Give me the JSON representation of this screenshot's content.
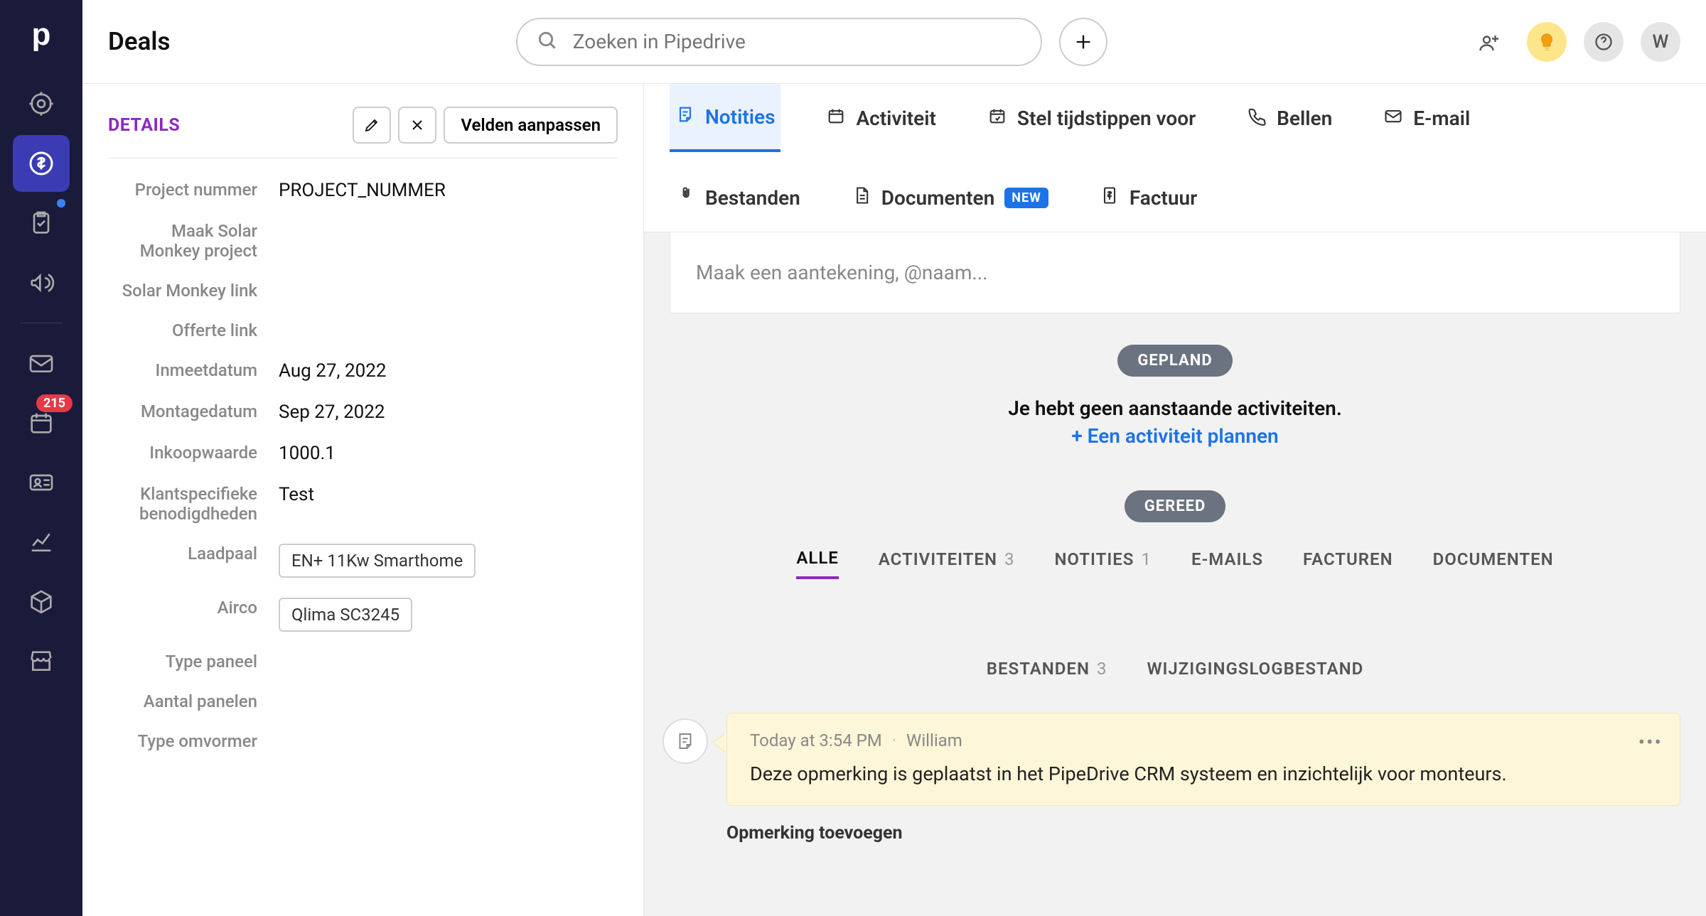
{
  "header": {
    "title": "Deals",
    "search_placeholder": "Zoeken in Pipedrive",
    "avatar_initial": "W"
  },
  "sidebar": {
    "badge_count": "215"
  },
  "details": {
    "title": "DETAILS",
    "edit_fields_label": "Velden aanpassen",
    "fields": [
      {
        "label": "Project nummer",
        "value": "PROJECT_NUMMER",
        "type": "text"
      },
      {
        "label": "Maak Solar Monkey project",
        "value": "",
        "type": "text"
      },
      {
        "label": "Solar Monkey link",
        "value": "",
        "type": "text"
      },
      {
        "label": "Offerte link",
        "value": "",
        "type": "text"
      },
      {
        "label": "Inmeetdatum",
        "value": "Aug 27, 2022",
        "type": "text"
      },
      {
        "label": "Montagedatum",
        "value": "Sep 27, 2022",
        "type": "text"
      },
      {
        "label": "Inkoopwaarde",
        "value": "1000.1",
        "type": "text"
      },
      {
        "label": "Klantspecifieke benodigdheden",
        "value": "Test",
        "type": "text"
      },
      {
        "label": "Laadpaal",
        "value": "EN+ 11Kw Smarthome",
        "type": "chip"
      },
      {
        "label": "Airco",
        "value": "Qlima SC3245",
        "type": "chip"
      },
      {
        "label": "Type paneel",
        "value": "",
        "type": "text"
      },
      {
        "label": "Aantal panelen",
        "value": "",
        "type": "text"
      },
      {
        "label": "Type omvormer",
        "value": "",
        "type": "text"
      }
    ]
  },
  "tabs": {
    "row1": [
      {
        "label": "Notities",
        "active": true
      },
      {
        "label": "Activiteit"
      },
      {
        "label": "Stel tijdstippen voor"
      },
      {
        "label": "Bellen"
      },
      {
        "label": "E-mail"
      }
    ],
    "row2": [
      {
        "label": "Bestanden"
      },
      {
        "label": "Documenten",
        "badge": "NEW"
      },
      {
        "label": "Factuur"
      }
    ]
  },
  "note_input_placeholder": "Maak een aantekening, @naam...",
  "planned": {
    "pill": "GEPLAND",
    "empty_text": "Je hebt geen aanstaande activiteiten.",
    "plan_link": "+ Een activiteit plannen"
  },
  "done": {
    "pill": "GEREED"
  },
  "filters": [
    {
      "label": "ALLE",
      "count": "",
      "active": true
    },
    {
      "label": "ACTIVITEITEN",
      "count": "3"
    },
    {
      "label": "NOTITIES",
      "count": "1"
    },
    {
      "label": "E-MAILS",
      "count": ""
    },
    {
      "label": "FACTUREN",
      "count": ""
    },
    {
      "label": "DOCUMENTEN",
      "count": ""
    },
    {
      "label": "BESTANDEN",
      "count": "3"
    },
    {
      "label": "WIJZIGINGSLOGBESTAND",
      "count": ""
    }
  ],
  "note": {
    "time": "Today at 3:54 PM",
    "author": "William",
    "body": "Deze opmerking is geplaatst in het PipeDrive CRM systeem en inzichtelijk voor monteurs."
  },
  "add_comment_label": "Opmerking toevoegen"
}
